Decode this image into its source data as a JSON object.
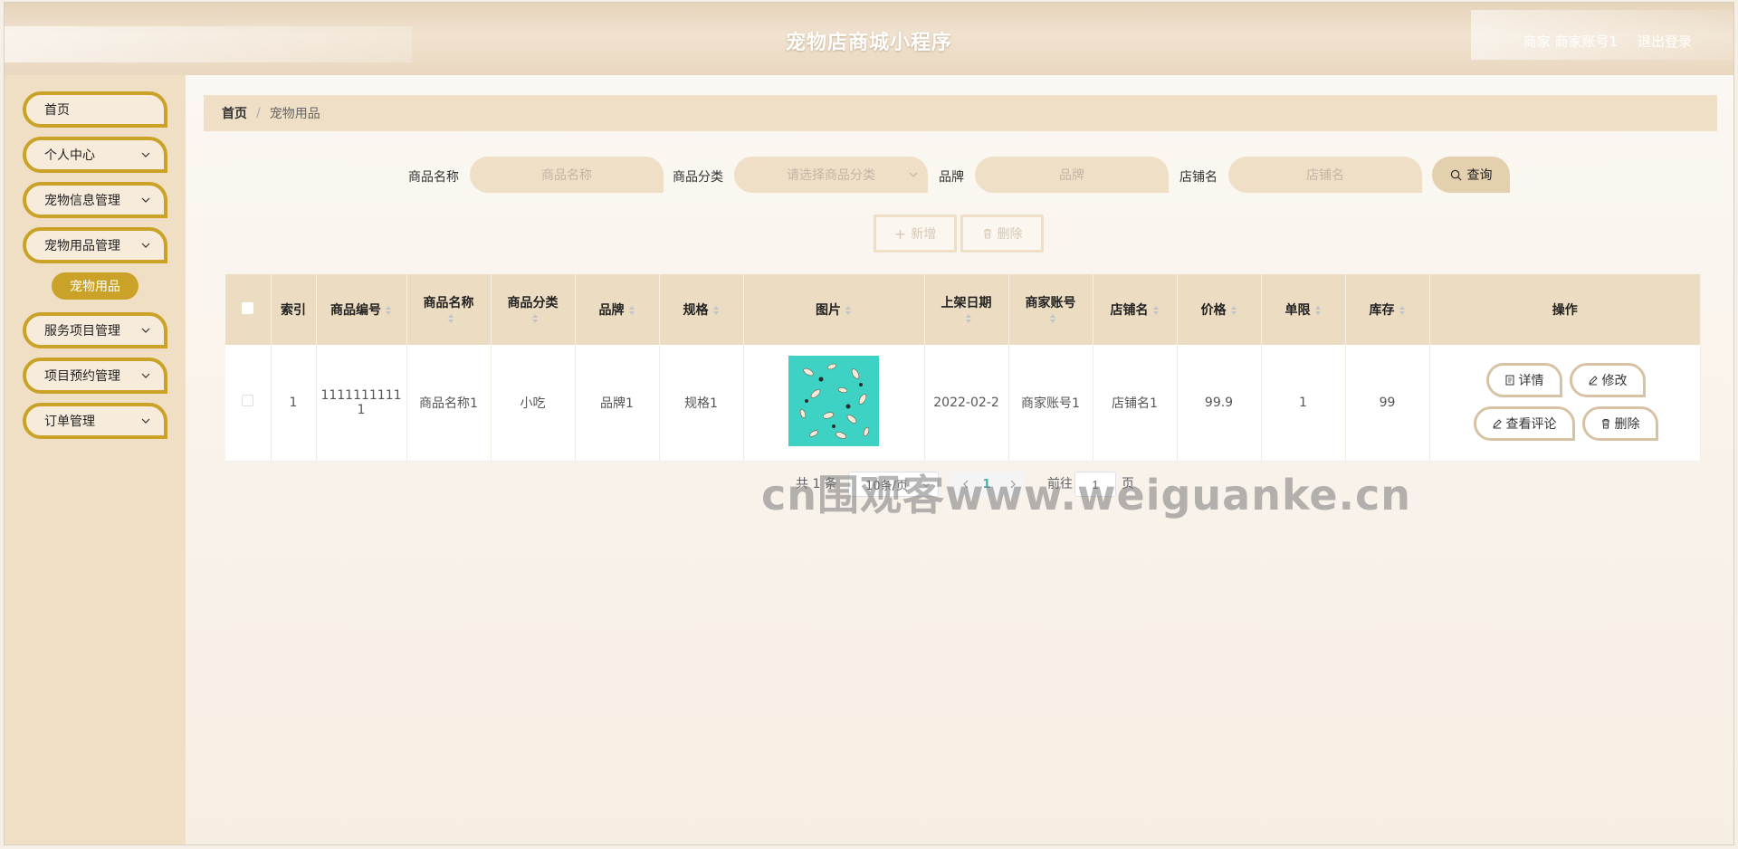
{
  "header": {
    "title": "宠物店商城小程序",
    "user": "商家 商家账号1",
    "logout": "退出登录"
  },
  "sidebar": {
    "items": [
      {
        "label": "首页"
      },
      {
        "label": "个人中心"
      },
      {
        "label": "宠物信息管理"
      },
      {
        "label": "宠物用品管理"
      },
      {
        "label": "服务项目管理"
      },
      {
        "label": "项目预约管理"
      },
      {
        "label": "订单管理"
      }
    ],
    "active_sub": "宠物用品"
  },
  "breadcrumb": {
    "home": "首页",
    "separator": "/",
    "current": "宠物用品"
  },
  "search": {
    "name_label": "商品名称",
    "name_placeholder": "商品名称",
    "category_label": "商品分类",
    "category_placeholder": "请选择商品分类",
    "brand_label": "品牌",
    "brand_placeholder": "品牌",
    "shop_label": "店铺名",
    "shop_placeholder": "店铺名",
    "query_button": "查询"
  },
  "actions": {
    "add": "新增",
    "delete": "删除"
  },
  "table": {
    "headers": {
      "index": "索引",
      "code": "商品编号",
      "name": "商品名称",
      "category": "商品分类",
      "brand": "品牌",
      "spec": "规格",
      "image": "图片",
      "date": "上架日期",
      "merchant": "商家账号",
      "shop": "店铺名",
      "price": "价格",
      "limit": "单限",
      "stock": "库存",
      "ops": "操作"
    },
    "rows": [
      {
        "index": "1",
        "code_line1": "1111111111",
        "code_line2": "1",
        "name": "商品名称1",
        "category": "小吃",
        "brand": "品牌1",
        "spec": "规格1",
        "date": "2022-02-2",
        "merchant": "商家账号1",
        "shop": "店铺名1",
        "price": "99.9",
        "limit": "1",
        "stock": "99",
        "ops": {
          "detail": "详情",
          "edit": "修改",
          "review": "查看评论",
          "delete": "删除"
        }
      }
    ]
  },
  "pagination": {
    "total": "共 1 条",
    "page_size": "10条/页",
    "current_page": "1",
    "goto_prefix": "前往",
    "goto_value": "1",
    "goto_suffix": "页"
  },
  "watermark": "cn围观客www.weiguanke.cn",
  "colors": {
    "accent": "#c9a227",
    "header": "#e9d7c0",
    "table_head": "#ecdcc2",
    "sidebar": "#f0dfc5"
  }
}
